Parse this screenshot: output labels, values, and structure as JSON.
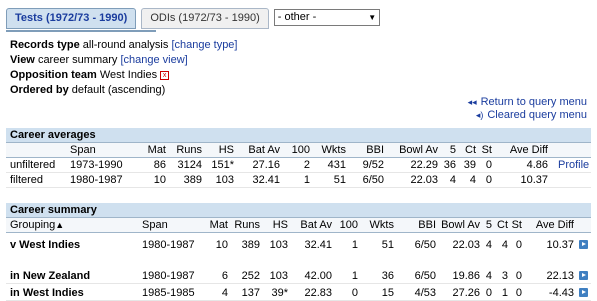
{
  "tabs": {
    "tests": "Tests (1972/73 - 1990)",
    "odis": "ODIs (1972/73 - 1990)",
    "other": "- other -"
  },
  "meta": {
    "records_type_label": "Records type",
    "records_type_value": "all-round analysis",
    "change_type": "[change type]",
    "view_label": "View",
    "view_value": "career summary",
    "change_view": "[change view]",
    "opposition_label": "Opposition team",
    "opposition_value": "West Indies",
    "ordered_label": "Ordered by",
    "ordered_value": "default (ascending)"
  },
  "query_links": {
    "return": "Return to query menu",
    "cleared": "Cleared query menu"
  },
  "career_averages": {
    "title": "Career averages",
    "headers": [
      "Span",
      "Mat",
      "Runs",
      "HS",
      "Bat Av",
      "100",
      "Wkts",
      "BBI",
      "Bowl Av",
      "5",
      "Ct",
      "St",
      "Ave Diff"
    ],
    "rows": [
      {
        "label": "unfiltered",
        "span": "1973-1990",
        "mat": "86",
        "runs": "3124",
        "hs": "151*",
        "batav": "27.16",
        "h": "2",
        "wkts": "431",
        "bbi": "9/52",
        "bowlav": "22.29",
        "five": "36",
        "ct": "39",
        "st": "0",
        "avediff": "4.86",
        "extra": "Profile"
      },
      {
        "label": "filtered",
        "span": "1980-1987",
        "mat": "10",
        "runs": "389",
        "hs": "103",
        "batav": "32.41",
        "h": "1",
        "wkts": "51",
        "bbi": "6/50",
        "bowlav": "22.03",
        "five": "4",
        "ct": "4",
        "st": "0",
        "avediff": "10.37",
        "extra": ""
      }
    ]
  },
  "career_summary": {
    "title": "Career summary",
    "headers": [
      "Grouping",
      "Span",
      "Mat",
      "Runs",
      "HS",
      "Bat Av",
      "100",
      "Wkts",
      "BBI",
      "Bowl Av",
      "5",
      "Ct",
      "St",
      "Ave Diff"
    ],
    "sort_arrow": "▲",
    "rows": [
      {
        "label": "v West Indies",
        "span": "1980-1987",
        "mat": "10",
        "runs": "389",
        "hs": "103",
        "batav": "32.41",
        "h": "1",
        "wkts": "51",
        "bbi": "6/50",
        "bowlav": "22.03",
        "five": "4",
        "ct": "4",
        "st": "0",
        "avediff": "10.37"
      },
      {
        "label": "in New Zealand",
        "span": "1980-1987",
        "mat": "6",
        "runs": "252",
        "hs": "103",
        "batav": "42.00",
        "h": "1",
        "wkts": "36",
        "bbi": "6/50",
        "bowlav": "19.86",
        "five": "4",
        "ct": "3",
        "st": "0",
        "avediff": "22.13"
      },
      {
        "label": "in West Indies",
        "span": "1985-1985",
        "mat": "4",
        "runs": "137",
        "hs": "39*",
        "batav": "22.83",
        "h": "0",
        "wkts": "15",
        "bbi": "4/53",
        "bowlav": "27.26",
        "five": "0",
        "ct": "1",
        "st": "0",
        "avediff": "-4.43"
      }
    ]
  }
}
